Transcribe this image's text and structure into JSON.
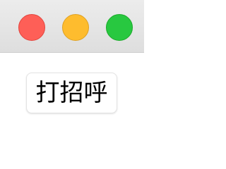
{
  "window": {
    "controls": {
      "close": {
        "icon": "close-circle-icon",
        "color": "#fe5f57"
      },
      "minimize": {
        "icon": "minimize-circle-icon",
        "color": "#febc2e"
      },
      "zoom": {
        "icon": "zoom-circle-icon",
        "color": "#28c840"
      }
    }
  },
  "main": {
    "greet_button_label": "打招呼"
  }
}
